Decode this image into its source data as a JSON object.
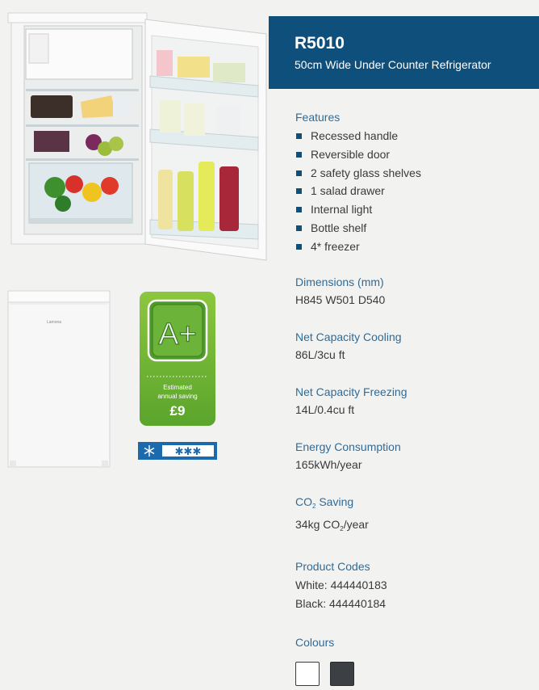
{
  "header": {
    "model": "R5010",
    "subtitle": "50cm Wide Under Counter Refrigerator"
  },
  "features": {
    "title": "Features",
    "items": [
      "Recessed handle",
      "Reversible door",
      "2 safety glass shelves",
      "1 salad drawer",
      "Internal light",
      "Bottle shelf",
      "4* freezer"
    ]
  },
  "dimensions": {
    "title": "Dimensions (mm)",
    "value": "H845  W501  D540"
  },
  "capacity_cooling": {
    "title": "Net Capacity Cooling",
    "value": "86L/3cu ft"
  },
  "capacity_freezing": {
    "title": "Net Capacity Freezing",
    "value": "14L/0.4cu ft"
  },
  "energy": {
    "title": "Energy Consumption",
    "value": "165kWh/year"
  },
  "co2": {
    "title_prefix": "CO",
    "title_sub": "2",
    "title_suffix": " Saving",
    "value_prefix": "34kg CO",
    "value_sub": "2",
    "value_suffix": "/year"
  },
  "codes": {
    "title": "Product Codes",
    "white": "White: 444440183",
    "black": "Black: 444440184"
  },
  "colours": {
    "title": "Colours",
    "swatches": [
      {
        "name": "white",
        "color": "#ffffff"
      },
      {
        "name": "black",
        "color": "#3c3f43"
      }
    ]
  },
  "badge": {
    "rating": "A+",
    "line1": "Estimated",
    "line2": "annual saving",
    "amount": "£9",
    "color": "#6fb236"
  },
  "freezer_rating": {
    "stars": "✱✱✱"
  },
  "logo_text": "Lamona"
}
